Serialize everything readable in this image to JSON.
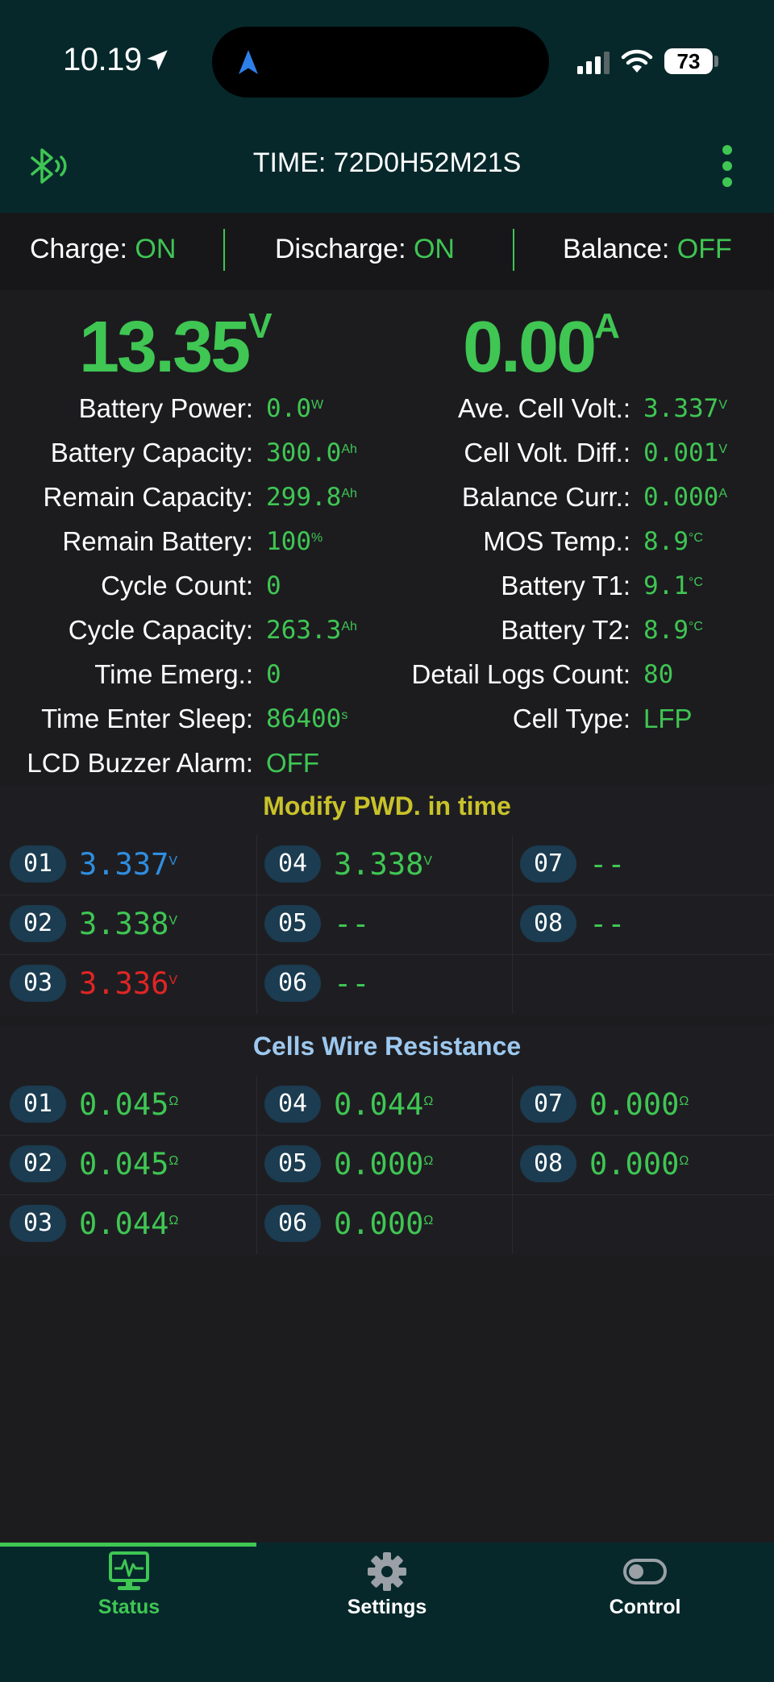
{
  "status_bar": {
    "time": "10.19",
    "battery": "73"
  },
  "header": {
    "title": "TIME: 72D0H52M21S",
    "icons": [
      "bluetooth-icon",
      "more-vert-icon"
    ]
  },
  "toggles": [
    {
      "label": "Charge:",
      "value": "ON"
    },
    {
      "label": "Discharge:",
      "value": "ON"
    },
    {
      "label": "Balance:",
      "value": "OFF"
    }
  ],
  "summary": {
    "voltage": "13.35",
    "voltage_unit": "V",
    "current": "0.00",
    "current_unit": "A"
  },
  "left_metrics": [
    {
      "label": "Battery Power:",
      "value": "0.0",
      "unit": "W"
    },
    {
      "label": "Battery Capacity:",
      "value": "300.0",
      "unit": "Ah"
    },
    {
      "label": "Remain Capacity:",
      "value": "299.8",
      "unit": "Ah"
    },
    {
      "label": "Remain Battery:",
      "value": "100",
      "unit": "%"
    },
    {
      "label": "Cycle Count:",
      "value": "0",
      "unit": ""
    },
    {
      "label": "Cycle Capacity:",
      "value": "263.3",
      "unit": "Ah"
    },
    {
      "label": "Time Emerg.:",
      "value": "0",
      "unit": ""
    },
    {
      "label": "Time Enter Sleep:",
      "value": "86400",
      "unit": "s"
    },
    {
      "label": "LCD Buzzer Alarm:",
      "value": "OFF",
      "unit": ""
    }
  ],
  "right_metrics": [
    {
      "label": "Ave. Cell Volt.:",
      "value": "3.337",
      "unit": "V"
    },
    {
      "label": "Cell Volt. Diff.:",
      "value": "0.001",
      "unit": "V"
    },
    {
      "label": "Balance Curr.:",
      "value": "0.000",
      "unit": "A"
    },
    {
      "label": "MOS Temp.:",
      "value": "8.9",
      "unit": "°C"
    },
    {
      "label": "Battery T1:",
      "value": "9.1",
      "unit": "°C"
    },
    {
      "label": "Battery T2:",
      "value": "8.9",
      "unit": "°C"
    },
    {
      "label": "Detail Logs Count:",
      "value": "80",
      "unit": ""
    },
    {
      "label": "Cell Type:",
      "value": "LFP",
      "unit": ""
    }
  ],
  "cell_voltages": {
    "title": "Modify PWD. in time",
    "title_color": "#c9c22a",
    "cells": [
      {
        "id": "01",
        "value": "3.337",
        "unit": "V",
        "color": "#2f8ee0"
      },
      {
        "id": "02",
        "value": "3.338",
        "unit": "V",
        "color": "#3fc653"
      },
      {
        "id": "03",
        "value": "3.336",
        "unit": "V",
        "color": "#e02525"
      },
      {
        "id": "04",
        "value": "3.338",
        "unit": "V",
        "color": "#3fc653"
      },
      {
        "id": "05",
        "value": "--",
        "unit": "",
        "color": "#3fc653"
      },
      {
        "id": "06",
        "value": "--",
        "unit": "",
        "color": "#3fc653"
      },
      {
        "id": "07",
        "value": "--",
        "unit": "",
        "color": "#3fc653"
      },
      {
        "id": "08",
        "value": "--",
        "unit": "",
        "color": "#3fc653"
      }
    ]
  },
  "wire_resistance": {
    "title": "Cells Wire Resistance",
    "title_color": "#9dc8ef",
    "cells": [
      {
        "id": "01",
        "value": "0.045",
        "unit": "Ω"
      },
      {
        "id": "02",
        "value": "0.045",
        "unit": "Ω"
      },
      {
        "id": "03",
        "value": "0.044",
        "unit": "Ω"
      },
      {
        "id": "04",
        "value": "0.044",
        "unit": "Ω"
      },
      {
        "id": "05",
        "value": "0.000",
        "unit": "Ω"
      },
      {
        "id": "06",
        "value": "0.000",
        "unit": "Ω"
      },
      {
        "id": "07",
        "value": "0.000",
        "unit": "Ω"
      },
      {
        "id": "08",
        "value": "0.000",
        "unit": "Ω"
      }
    ]
  },
  "tabs": [
    {
      "label": "Status",
      "icon": "monitor-icon",
      "active": true
    },
    {
      "label": "Settings",
      "icon": "gear-icon",
      "active": false
    },
    {
      "label": "Control",
      "icon": "toggle-icon",
      "active": false
    }
  ],
  "colors": {
    "accent": "#3fc653",
    "header_bg": "#06282b",
    "bg": "#1c1c1f"
  }
}
